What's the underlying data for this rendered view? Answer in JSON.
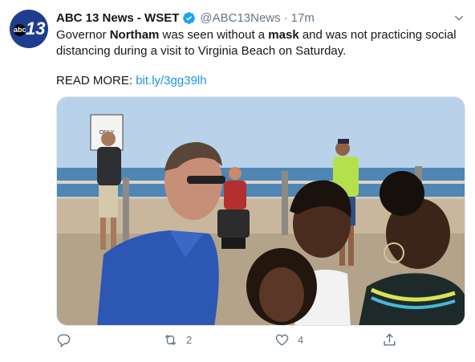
{
  "tweet": {
    "author_name": "ABC 13 News - WSET",
    "handle": "@ABC13News",
    "separator": "·",
    "time": "17m",
    "avatar_text_small": "abc",
    "avatar_text_big": "13",
    "text_parts": {
      "p1": "Governor ",
      "b1": "Northam",
      "p2": " was seen without a ",
      "b2": "mask",
      "p3": " and was not practicing social distancing during a visit to Virginia Beach on Saturday."
    },
    "read_more_label": "READ MORE: ",
    "link": "bit.ly/3gg39lh",
    "sign_text": "ONLY",
    "actions": {
      "reply_count": "",
      "retweet_count": "2",
      "like_count": "4"
    },
    "icons": [
      "verified-badge-icon",
      "caret-down-icon",
      "reply-icon",
      "retweet-icon",
      "like-icon",
      "share-icon"
    ],
    "colors": {
      "accent": "#1da1f2",
      "link": "#1b95e0",
      "muted": "#657786"
    }
  }
}
